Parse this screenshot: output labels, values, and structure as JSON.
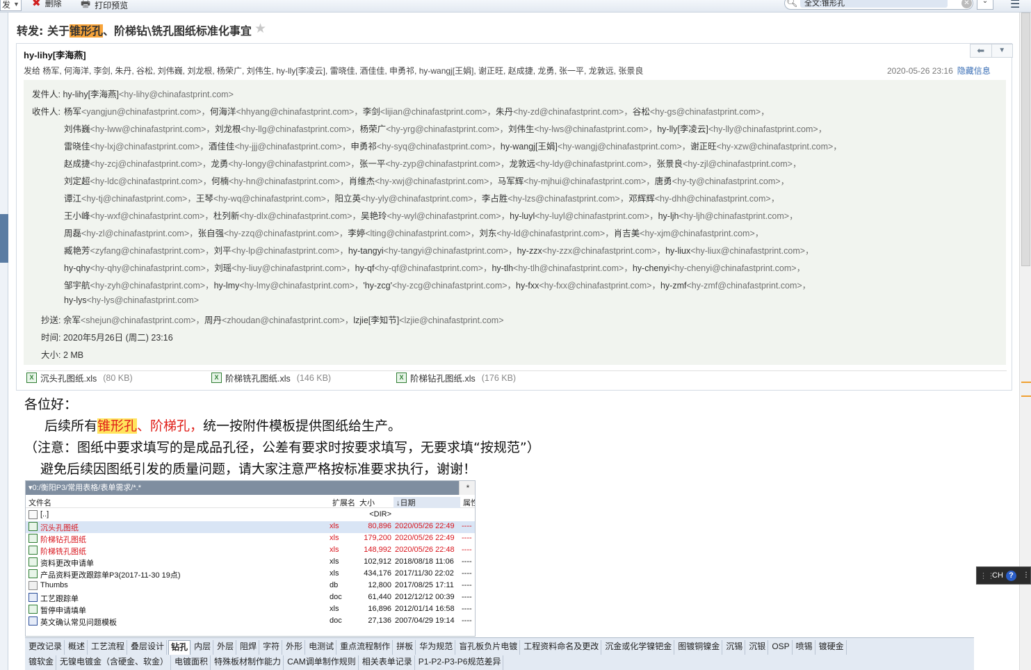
{
  "toolbar": {
    "reply_label": "发",
    "delete_label": "删除",
    "print_label": "打印预览",
    "search_value": "全文:锥形孔"
  },
  "email": {
    "subject_prefix": "转发: 关于",
    "subject_highlight": "锥形孔",
    "subject_rest": "、阶梯钻\\铣孔图纸标准化事宜",
    "sender": "hy-lihy[李海燕]",
    "to_summary": "发给 杨军, 何海洋, 李剑, 朱丹, 谷松, 刘伟巍, 刘龙根, 杨荣广, 刘伟生, hy-lly[李凌云], 雷晓佳, 酒佳佳, 申勇祁, hy-wangj[王娟], 谢正旺, 赵成捷, 龙勇, 张一平, 龙敦远, 张景良",
    "date": "2020-05-26 23:16",
    "hide_info": "隐藏信息",
    "details": {
      "from_label": "发件人:",
      "from_name": "hy-lihy[李海燕]",
      "from_email": "<hy-lihy@chinafastprint.com>",
      "to_label": "收件人:",
      "to_lines": [
        [
          [
            "杨军",
            "<yangjun@chinafastprint.com>，"
          ],
          [
            "何海洋",
            "<hhyang@chinafastprint.com>，"
          ],
          [
            "李剑",
            "<lijian@chinafastprint.com>，"
          ],
          [
            "朱丹",
            "<hy-zd@chinafastprint.com>，"
          ],
          [
            "谷松",
            "<hy-gs@chinafastprint.com>，"
          ]
        ],
        [
          [
            "刘伟巍",
            "<hy-lww@chinafastprint.com>，"
          ],
          [
            "刘龙根",
            "<hy-llg@chinafastprint.com>，"
          ],
          [
            "杨荣广",
            "<hy-yrg@chinafastprint.com>，"
          ],
          [
            "刘伟生",
            "<hy-lws@chinafastprint.com>，"
          ],
          [
            "hy-lly[李凌云]",
            "<hy-lly@chinafastprint.com>，"
          ]
        ],
        [
          [
            "雷晓佳",
            "<hy-lxj@chinafastprint.com>，"
          ],
          [
            "酒佳佳",
            "<hy-jjj@chinafastprint.com>，"
          ],
          [
            "申勇祁",
            "<hy-syq@chinafastprint.com>，"
          ],
          [
            "hy-wangj[王娟]",
            "<hy-wangj@chinafastprint.com>，"
          ],
          [
            "谢正旺",
            "<hy-xzw@chinafastprint.com>，"
          ]
        ],
        [
          [
            "赵成捷",
            "<hy-zcj@chinafastprint.com>，"
          ],
          [
            "龙勇",
            "<hy-longy@chinafastprint.com>，"
          ],
          [
            "张一平",
            "<hy-zyp@chinafastprint.com>，"
          ],
          [
            "龙敦远",
            "<hy-ldy@chinafastprint.com>，"
          ],
          [
            "张景良",
            "<hy-zjl@chinafastprint.com>，"
          ]
        ],
        [
          [
            "刘定超",
            "<hy-ldc@chinafastprint.com>，"
          ],
          [
            "何楠",
            "<hy-hn@chinafastprint.com>，"
          ],
          [
            "肖维杰",
            "<hy-xwj@chinafastprint.com>，"
          ],
          [
            "马军辉",
            "<hy-mjhui@chinafastprint.com>，"
          ],
          [
            "唐勇",
            "<hy-ty@chinafastprint.com>，"
          ]
        ],
        [
          [
            "谭江",
            "<hy-tj@chinafastprint.com>，"
          ],
          [
            "王琴",
            "<hy-wq@chinafastprint.com>，"
          ],
          [
            "阳立英",
            "<hy-yly@chinafastprint.com>，"
          ],
          [
            "李占胜",
            "<hy-lzs@chinafastprint.com>，"
          ],
          [
            "邓辉辉",
            "<hy-dhh@chinafastprint.com>，"
          ]
        ],
        [
          [
            "王小峰",
            "<hy-wxf@chinafastprint.com>，"
          ],
          [
            "杜列新",
            "<hy-dlx@chinafastprint.com>，"
          ],
          [
            "吴艳玲",
            "<hy-wyl@chinafastprint.com>，"
          ],
          [
            "hy-luyl",
            "<hy-luyl@chinafastprint.com>，"
          ],
          [
            "hy-ljh",
            "<hy-ljh@chinafastprint.com>，"
          ]
        ],
        [
          [
            "周磊",
            "<hy-zl@chinafastprint.com>，"
          ],
          [
            "张自强",
            "<hy-zzq@chinafastprint.com>，"
          ],
          [
            "李婷",
            "<lting@chinafastprint.com>，"
          ],
          [
            "刘东",
            "<hy-ld@chinafastprint.com>，"
          ],
          [
            "肖吉美",
            "<hy-xjm@chinafastprint.com>，"
          ]
        ],
        [
          [
            "臧艳芳",
            "<zyfang@chinafastprint.com>，"
          ],
          [
            "刘平",
            "<hy-lp@chinafastprint.com>，"
          ],
          [
            "hy-tangyi",
            "<hy-tangyi@chinafastprint.com>，"
          ],
          [
            "hy-zzx",
            "<hy-zzx@chinafastprint.com>，"
          ],
          [
            "hy-liux",
            "<hy-liux@chinafastprint.com>，"
          ]
        ],
        [
          [
            "hy-qhy",
            "<hy-qhy@chinafastprint.com>，"
          ],
          [
            "刘瑶",
            "<hy-liuy@chinafastprint.com>，"
          ],
          [
            "hy-qf",
            "<hy-qf@chinafastprint.com>，"
          ],
          [
            "hy-tlh",
            "<hy-tlh@chinafastprint.com>，"
          ],
          [
            "hy-chenyi",
            "<hy-chenyi@chinafastprint.com>，"
          ]
        ],
        [
          [
            "邹宇航",
            "<hy-zyh@chinafastprint.com>，"
          ],
          [
            "hy-lmy",
            "<hy-lmy@chinafastprint.com>，"
          ],
          [
            "'hy-zcg'",
            "<hy-zcg@chinafastprint.com>，"
          ],
          [
            "hy-fxx",
            "<hy-fxx@chinafastprint.com>，"
          ],
          [
            "hy-zmf",
            "<hy-zmf@chinafastprint.com>，"
          ]
        ],
        [
          [
            "hy-lys",
            "<hy-lys@chinafastprint.com>"
          ]
        ]
      ],
      "cc_label": "抄送:",
      "cc": [
        [
          "佘军",
          "<shejun@chinafastprint.com>，"
        ],
        [
          "周丹",
          "<zhoudan@chinafastprint.com>，"
        ],
        [
          "lzjie[李知节]",
          "<lzjie@chinafastprint.com>"
        ]
      ],
      "time_label": "时间:",
      "time_value": "2020年5月26日 (周二) 23:16",
      "size_label": "大小:",
      "size_value": "2 MB"
    },
    "attachments": [
      {
        "name": "沉头孔图纸.xls",
        "size": "(80 KB)"
      },
      {
        "name": "阶梯铣孔图纸.xls",
        "size": "(146 KB)"
      },
      {
        "name": "阶梯钻孔图纸.xls",
        "size": "(176 KB)"
      }
    ],
    "body": {
      "greeting": "各位好：",
      "line1_a": "后续所有",
      "line1_hl": "锥形孔",
      "line1_red": "、阶梯孔，",
      "line1_b": "统一按附件模板提供图纸给生产。",
      "line2": "（注意：图纸中要求填写的是成品孔径，公差有要求时按要求填写，无要求填“按规范”）",
      "line3": "避免后续因图纸引发的质量问题，请大家注意严格按标准要求执行，谢谢！"
    }
  },
  "file_manager": {
    "path": "0:/衡阳P3/常用表格/表单需求/*.*",
    "star": "*",
    "columns": {
      "name": "文件名",
      "ext": "扩展名",
      "size": "大小",
      "date": "↓日期",
      "attr": "属性"
    },
    "rows": [
      {
        "icon": "up",
        "name": "[..]",
        "ext": "",
        "size": "<DIR>",
        "date": "",
        "attr": "",
        "red": false,
        "selected": false
      },
      {
        "icon": "xls",
        "name": "沉头孔图纸",
        "ext": "xls",
        "size": "80,896",
        "date": "2020/05/26 22:49",
        "attr": "----",
        "red": true,
        "selected": true
      },
      {
        "icon": "xls",
        "name": "阶梯钻孔图纸",
        "ext": "xls",
        "size": "179,200",
        "date": "2020/05/26 22:49",
        "attr": "----",
        "red": true,
        "selected": false
      },
      {
        "icon": "xls",
        "name": "阶梯铣孔图纸",
        "ext": "xls",
        "size": "148,992",
        "date": "2020/05/26 22:48",
        "attr": "----",
        "red": true,
        "selected": false
      },
      {
        "icon": "xls",
        "name": "资料更改申请单",
        "ext": "xls",
        "size": "102,912",
        "date": "2018/08/18 11:06",
        "attr": "----",
        "red": false,
        "selected": false
      },
      {
        "icon": "xls",
        "name": "产品资料更改跟踪单P3(2017-11-30 19点)",
        "ext": "xls",
        "size": "434,176",
        "date": "2017/11/30 22:02",
        "attr": "----",
        "red": false,
        "selected": false
      },
      {
        "icon": "db",
        "name": "Thumbs",
        "ext": "db",
        "size": "12,800",
        "date": "2017/08/25 17:11",
        "attr": "----",
        "red": false,
        "selected": false
      },
      {
        "icon": "doc",
        "name": "工艺跟踪单",
        "ext": "doc",
        "size": "61,440",
        "date": "2012/12/12 00:39",
        "attr": "----",
        "red": false,
        "selected": false
      },
      {
        "icon": "xls",
        "name": "暂停申请填单",
        "ext": "xls",
        "size": "16,896",
        "date": "2012/01/14 16:58",
        "attr": "----",
        "red": false,
        "selected": false
      },
      {
        "icon": "doc",
        "name": "英文确认常见问题模板",
        "ext": "doc",
        "size": "27,136",
        "date": "2007/04/29 19:14",
        "attr": "----",
        "red": false,
        "selected": false
      }
    ]
  },
  "tabs_row1": [
    "更改记录",
    "概述",
    "工艺流程",
    "叠层设计",
    "钻孔",
    "内层",
    "外层",
    "阻焊",
    "字符",
    "外形",
    "电测试",
    "重点流程制作",
    "拼板",
    "华为规范",
    "盲孔板负片电镀",
    "工程资料命名及更改",
    "沉金或化学镍钯金",
    "图镀铜镍金",
    "沉锡",
    "沉银",
    "OSP",
    "喷锡",
    "镀硬金"
  ],
  "tabs_row2": [
    "镀软金",
    "无镍电镀金（含硬金、软金）",
    "电镀面积",
    "特殊板材制作能力",
    "CAM调单制作规则",
    "相关表单记录",
    "P1-P2-P3-P6规范差异"
  ],
  "active_tab": "钻孔",
  "ime": {
    "lang": "CH",
    "help": "?"
  }
}
